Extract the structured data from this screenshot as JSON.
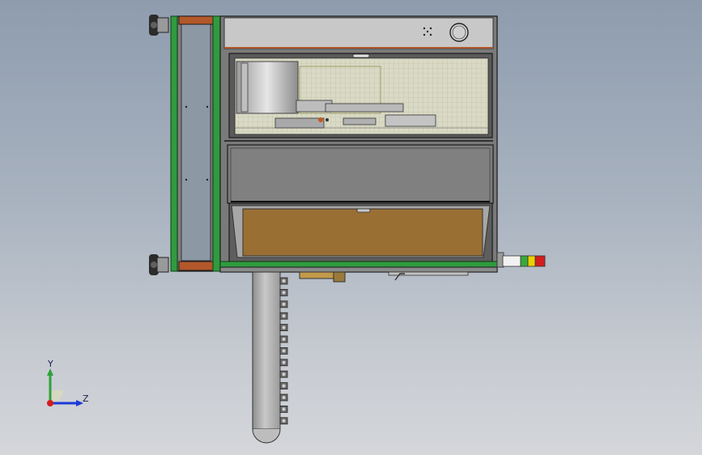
{
  "view": {
    "background_top": "#8e9cae",
    "background_bottom": "#d4d6da"
  },
  "colors": {
    "frame_green": "#2f9b3e",
    "panel_orange": "#b2582a",
    "hopper_fill": "#9a6f34",
    "steel_gray": "#8a8a8a",
    "light_gray": "#c8c8c8"
  },
  "icons": {
    "caster_wheel": "caster-wheel-icon",
    "knob": "knob-icon",
    "grille": "grille-icon",
    "tower_light": "tower-light-icon",
    "triad": "axis-triad-icon"
  },
  "tower_light": {
    "segments": [
      "#f2f2f2",
      "#3aa83a",
      "#e8d200",
      "#d21f1f"
    ]
  },
  "triad": {
    "y_label": "Y",
    "z_label": "Z",
    "y_color": "#2fa13a",
    "z_color": "#1c3ad6",
    "origin_color": "#d41c1c"
  }
}
